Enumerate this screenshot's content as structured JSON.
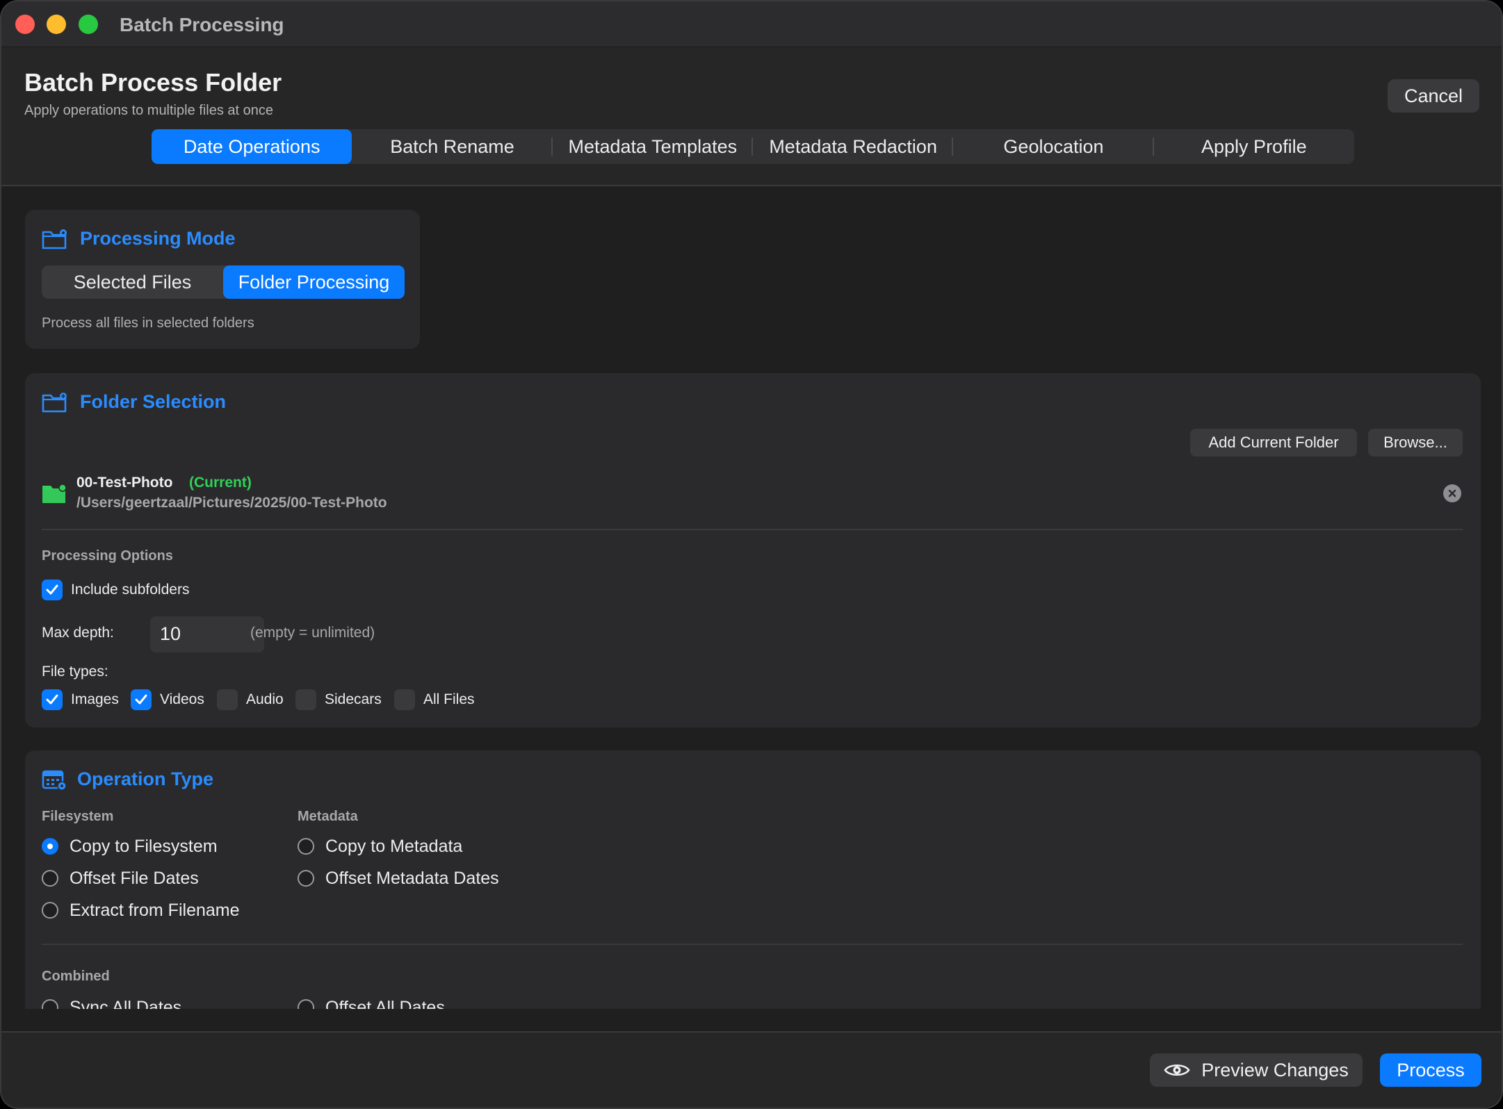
{
  "window": {
    "title": "Batch Processing"
  },
  "header": {
    "title": "Batch Process Folder",
    "subtitle": "Apply operations to multiple files at once",
    "cancel_label": "Cancel",
    "tabs": [
      {
        "label": "Date Operations",
        "active": true
      },
      {
        "label": "Batch Rename",
        "active": false
      },
      {
        "label": "Metadata Templates",
        "active": false
      },
      {
        "label": "Metadata Redaction",
        "active": false
      },
      {
        "label": "Geolocation",
        "active": false
      },
      {
        "label": "Apply Profile",
        "active": false
      }
    ]
  },
  "processing_mode": {
    "title": "Processing Mode",
    "options": [
      "Selected Files",
      "Folder Processing"
    ],
    "selected": "Folder Processing",
    "description": "Process all files in selected folders"
  },
  "folder_selection": {
    "title": "Folder Selection",
    "add_current_label": "Add Current Folder",
    "browse_label": "Browse...",
    "folder": {
      "name": "00-Test-Photo",
      "badge": "(Current)",
      "path": "/Users/geertzaal/Pictures/2025/00-Test-Photo"
    },
    "options_label": "Processing Options",
    "include_subfolders": {
      "label": "Include subfolders",
      "checked": true
    },
    "max_depth": {
      "label": "Max depth:",
      "value": "10",
      "hint": "(empty = unlimited)"
    },
    "file_types_label": "File types:",
    "file_types": [
      {
        "label": "Images",
        "checked": true
      },
      {
        "label": "Videos",
        "checked": true
      },
      {
        "label": "Audio",
        "checked": false
      },
      {
        "label": "Sidecars",
        "checked": false
      },
      {
        "label": "All Files",
        "checked": false
      }
    ]
  },
  "operation_type": {
    "title": "Operation Type",
    "filesystem_label": "Filesystem",
    "metadata_label": "Metadata",
    "combined_label": "Combined",
    "filesystem_options": [
      "Copy to Filesystem",
      "Offset File Dates",
      "Extract from Filename"
    ],
    "metadata_options": [
      "Copy to Metadata",
      "Offset Metadata Dates"
    ],
    "combined_options": [
      "Sync All Dates",
      "Offset All Dates"
    ],
    "selected": "Copy to Filesystem"
  },
  "footer": {
    "preview_label": "Preview Changes",
    "process_label": "Process"
  },
  "colors": {
    "accent": "#0a7aff",
    "success": "#30d158",
    "title_accent": "#2a8cff"
  }
}
